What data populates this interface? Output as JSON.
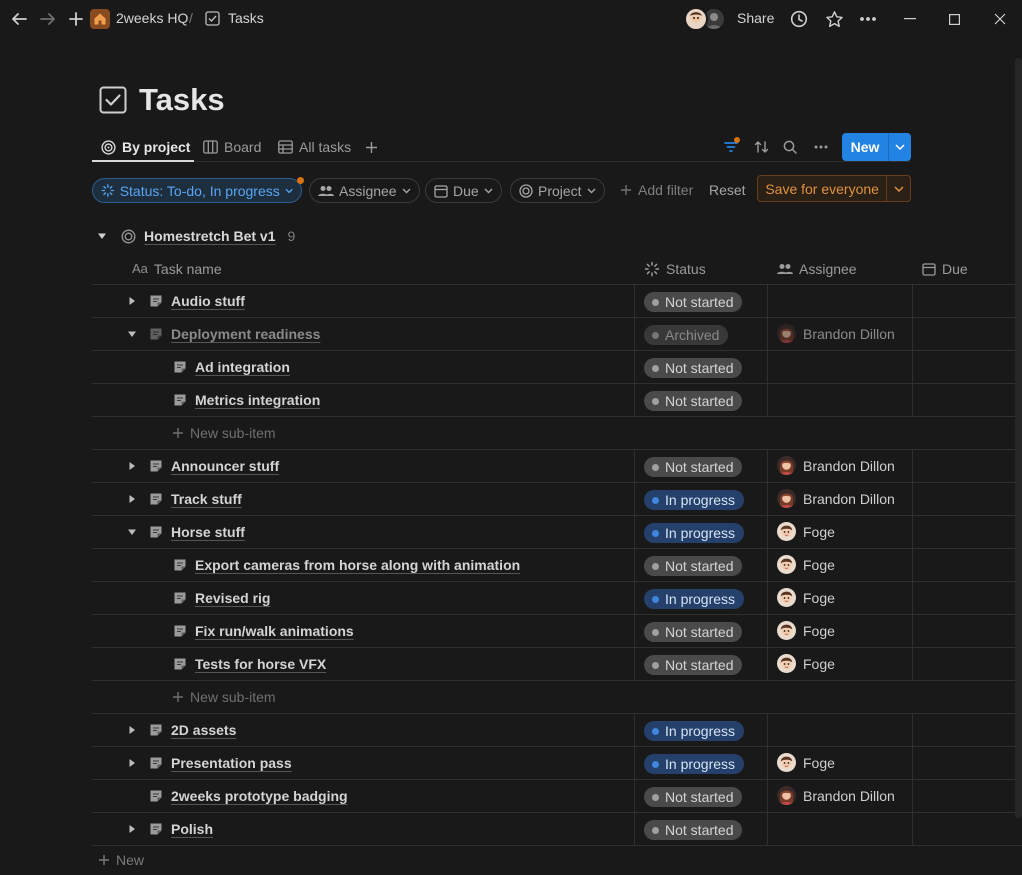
{
  "breadcrumb": {
    "workspace": "2weeks HQ",
    "separator": "/",
    "page": "Tasks"
  },
  "topbar": {
    "share_label": "Share"
  },
  "page": {
    "title": "Tasks"
  },
  "views": [
    {
      "label": "By project"
    },
    {
      "label": "Board"
    },
    {
      "label": "All tasks"
    }
  ],
  "toolbar": {
    "new_label": "New"
  },
  "filters": {
    "status": "Status: To-do, In progress",
    "assignee": "Assignee",
    "due": "Due",
    "project": "Project",
    "add_filter": "Add filter",
    "reset": "Reset",
    "save": "Save for everyone"
  },
  "group": {
    "title": "Homestretch Bet v1",
    "count": "9"
  },
  "columns": {
    "name_prefix": "Aa",
    "name": "Task name",
    "status": "Status",
    "assignee": "Assignee",
    "due": "Due"
  },
  "rows": [
    {
      "name": "Audio stuff",
      "status": "Not started",
      "assignee": ""
    },
    {
      "name": "Deployment readiness",
      "status": "Archived",
      "assignee": "Brandon Dillon"
    },
    {
      "name": "Ad integration",
      "status": "Not started",
      "assignee": ""
    },
    {
      "name": "Metrics integration",
      "status": "Not started",
      "assignee": ""
    },
    {
      "name": "Announcer stuff",
      "status": "Not started",
      "assignee": "Brandon Dillon"
    },
    {
      "name": "Track stuff",
      "status": "In progress",
      "assignee": "Brandon Dillon"
    },
    {
      "name": "Horse stuff",
      "status": "In progress",
      "assignee": "Foge"
    },
    {
      "name": "Export cameras from horse along with animation",
      "status": "Not started",
      "assignee": "Foge"
    },
    {
      "name": "Revised rig",
      "status": "In progress",
      "assignee": "Foge"
    },
    {
      "name": "Fix run/walk animations",
      "status": "Not started",
      "assignee": "Foge"
    },
    {
      "name": "Tests for horse VFX",
      "status": "Not started",
      "assignee": "Foge"
    },
    {
      "name": "2D assets",
      "status": "In progress",
      "assignee": ""
    },
    {
      "name": "Presentation pass",
      "status": "In progress",
      "assignee": "Foge"
    },
    {
      "name": "2weeks prototype badging",
      "status": "Not started",
      "assignee": "Brandon Dillon"
    },
    {
      "name": "Polish",
      "status": "Not started",
      "assignee": ""
    }
  ],
  "sub_item_label": "New sub-item",
  "new_row_label": "New",
  "colors": {
    "background": "#191919",
    "accent": "#2383e2",
    "warning": "#e0923d",
    "in_progress": "#3f86de"
  }
}
